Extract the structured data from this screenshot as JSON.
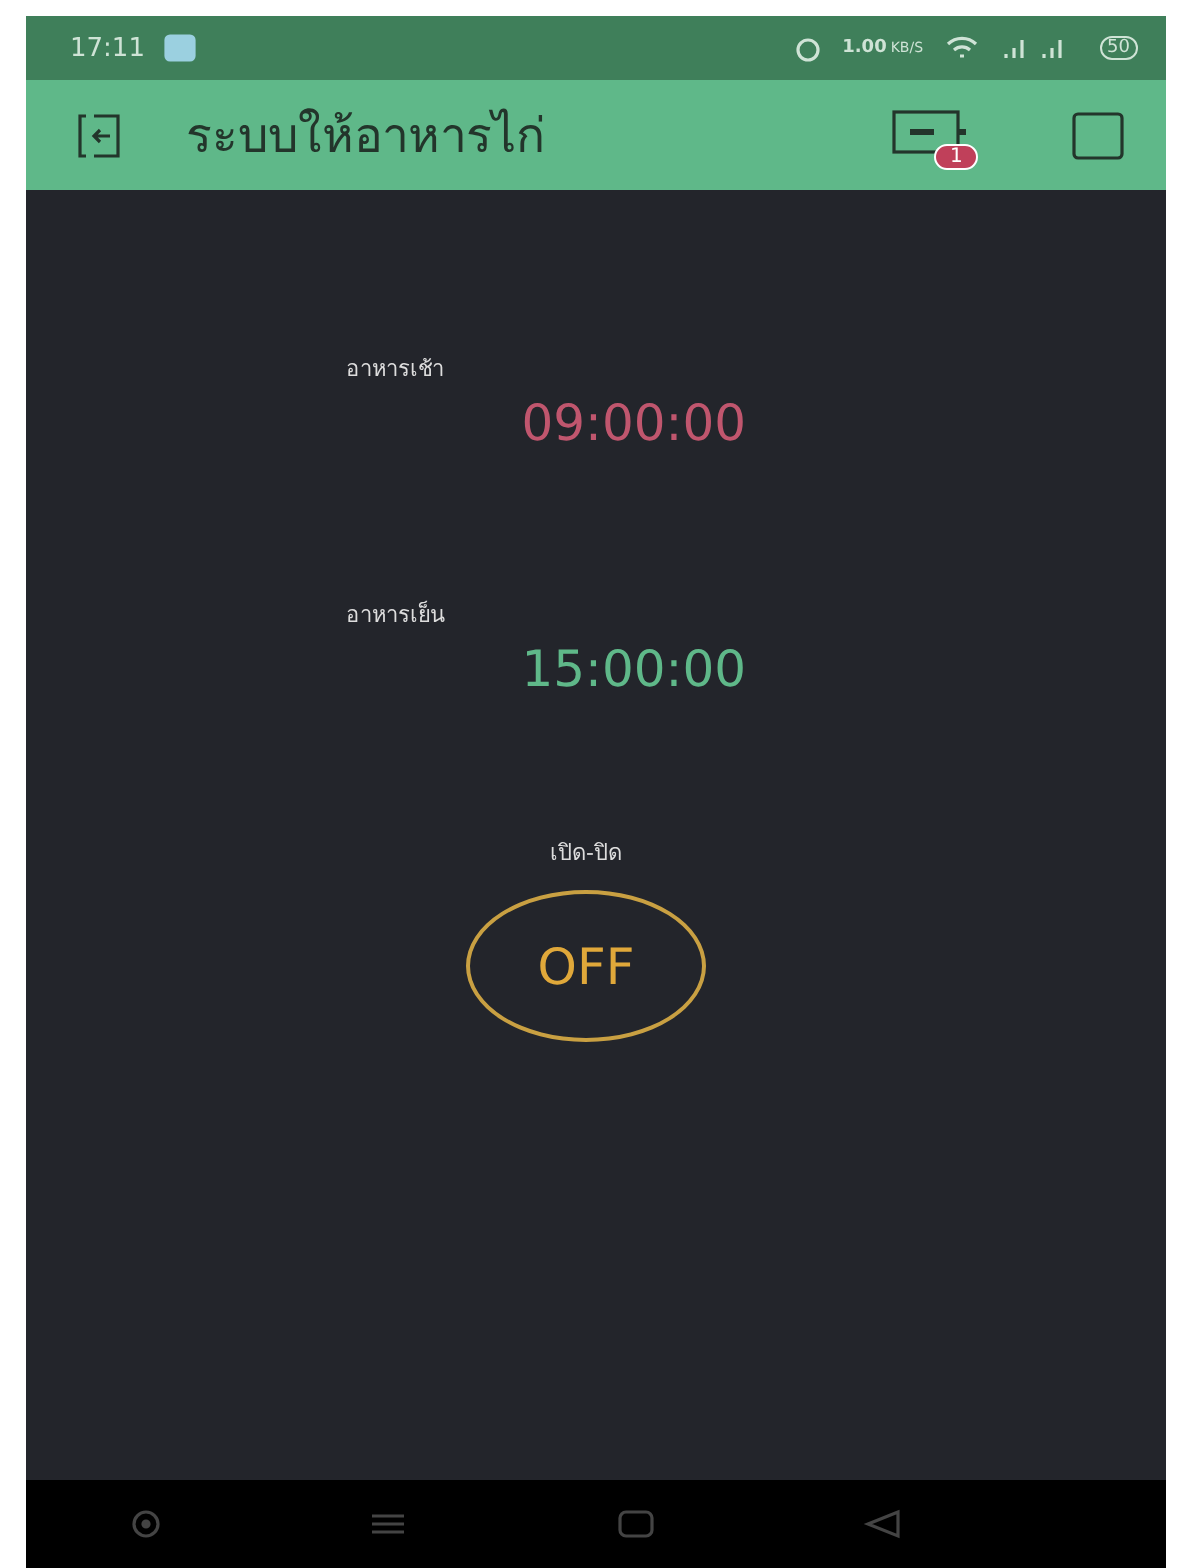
{
  "status_bar": {
    "time": "17:11",
    "speed": "1.00",
    "speed_unit": "KB/S",
    "battery": "50"
  },
  "header": {
    "title": "ระบบให้อาหารไก่",
    "badge": "1"
  },
  "timers": [
    {
      "label": "อาหารเช้า",
      "value": "09:00:00",
      "color": "#c0566e"
    },
    {
      "label": "อาหารเย็น",
      "value": "15:00:00",
      "color": "#5fb889"
    }
  ],
  "switch": {
    "label": "เปิด-ปิด",
    "text": "OFF",
    "on": false
  }
}
